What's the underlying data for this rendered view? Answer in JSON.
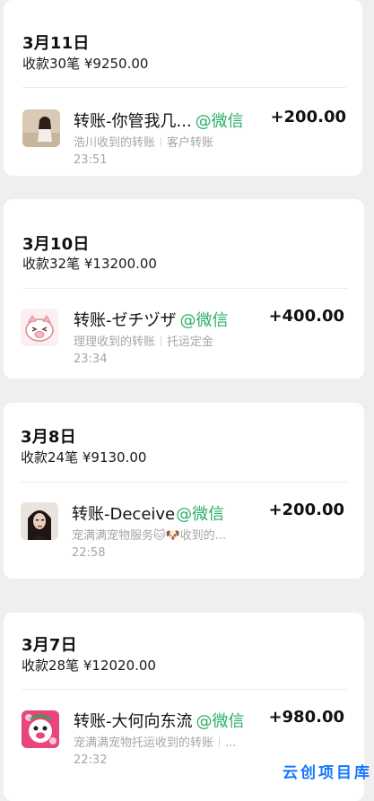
{
  "days": [
    {
      "date": "3月11日",
      "summary": "收款30笔 ¥9250.00",
      "transaction": {
        "title": "转账-你管我几...",
        "source": "@微信",
        "amount": "+200.00",
        "subtitle_main": "浩川收到的转账",
        "subtitle_extra": "客户转账",
        "time": "23:51",
        "avatar_icon": "girl-photo-icon"
      }
    },
    {
      "date": "3月10日",
      "summary": "收款32笔 ¥13200.00",
      "transaction": {
        "title": "转账-ゼチヅザ",
        "source": "@微信",
        "amount": "+400.00",
        "subtitle_main": "理理收到的转账",
        "subtitle_extra": "托运定金",
        "time": "23:34",
        "avatar_icon": "cartoon-pig-icon"
      }
    },
    {
      "date": "3月8日",
      "summary": "收款24笔 ¥9130.00",
      "transaction": {
        "title": "转账-Deceive",
        "source": "@微信",
        "amount": "+200.00",
        "subtitle_main": "宠满满宠物服务🐱🐶收到的...",
        "subtitle_extra": "",
        "time": "22:58",
        "avatar_icon": "woman-portrait-icon"
      }
    },
    {
      "date": "3月7日",
      "summary": "收款28笔 ¥12020.00",
      "transaction": {
        "title": "转账-大何向东流",
        "source": "@微信",
        "amount": "+980.00",
        "subtitle_main": "宠满满宠物托运收到的转账",
        "subtitle_extra": "...",
        "time": "22:32",
        "avatar_icon": "cartoon-character-icon"
      }
    }
  ],
  "watermark": "云创项目库",
  "colors": {
    "wechat_green": "#2aae67",
    "watermark_blue": "#1677ff",
    "muted_text": "#a6a6a6",
    "page_bg": "#efefef"
  }
}
